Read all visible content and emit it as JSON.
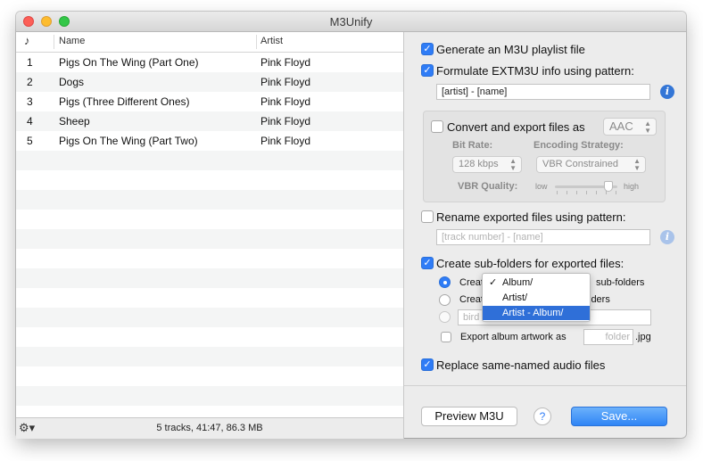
{
  "window": {
    "title": "M3Unify"
  },
  "table": {
    "headers": {
      "number_icon": "♪",
      "name": "Name",
      "artist": "Artist"
    },
    "rows": [
      {
        "num": "1",
        "name": "Pigs On The Wing (Part One)",
        "artist": "Pink Floyd"
      },
      {
        "num": "2",
        "name": "Dogs",
        "artist": "Pink Floyd"
      },
      {
        "num": "3",
        "name": "Pigs (Three Different Ones)",
        "artist": "Pink Floyd"
      },
      {
        "num": "4",
        "name": "Sheep",
        "artist": "Pink Floyd"
      },
      {
        "num": "5",
        "name": "Pigs On The Wing (Part Two)",
        "artist": "Pink Floyd"
      }
    ]
  },
  "status": {
    "text": "5 tracks, 41:47, 86.3 MB",
    "gear_icon": "gear-icon"
  },
  "options": {
    "generate_m3u": {
      "label": "Generate an M3U playlist file",
      "checked": true
    },
    "extm3u": {
      "label": "Formulate EXTM3U info using pattern:",
      "checked": true,
      "pattern": "[artist] - [name]"
    },
    "convert": {
      "label": "Convert and export files as",
      "checked": false,
      "format": "AAC",
      "bitrate_label": "Bit Rate:",
      "bitrate": "128 kbps",
      "strategy_label": "Encoding Strategy:",
      "strategy": "VBR Constrained",
      "vbr_label": "VBR Quality:",
      "vbr_low": "low",
      "vbr_high": "high",
      "vbr_level": 0.85
    },
    "rename": {
      "label": "Rename exported files using pattern:",
      "checked": false,
      "placeholder": "[track number] - [name]"
    },
    "subfolders": {
      "label": "Create sub-folders for exported files:",
      "checked": true,
      "radio1_prefix": "Creat",
      "radio1_suffix": "sub-folders",
      "radio2_prefix": "Creat",
      "radio2_suffix": "lders",
      "radio3_field": "bird",
      "menu_items": [
        {
          "label": "Album/",
          "checked": true
        },
        {
          "label": "Artist/",
          "checked": false
        },
        {
          "label": "Artist - Album/",
          "checked": false
        }
      ],
      "artwork_label": "Export album artwork as",
      "artwork_placeholder": "folder",
      "artwork_ext": ".jpg"
    },
    "replace": {
      "label": "Replace same-named audio files",
      "checked": true
    }
  },
  "buttons": {
    "preview": "Preview M3U",
    "help": "?",
    "save": "Save..."
  },
  "colors": {
    "accent": "#2f7cf6",
    "close": "#fc5f57",
    "minimize": "#fdbc2e",
    "maximize": "#33c748"
  }
}
